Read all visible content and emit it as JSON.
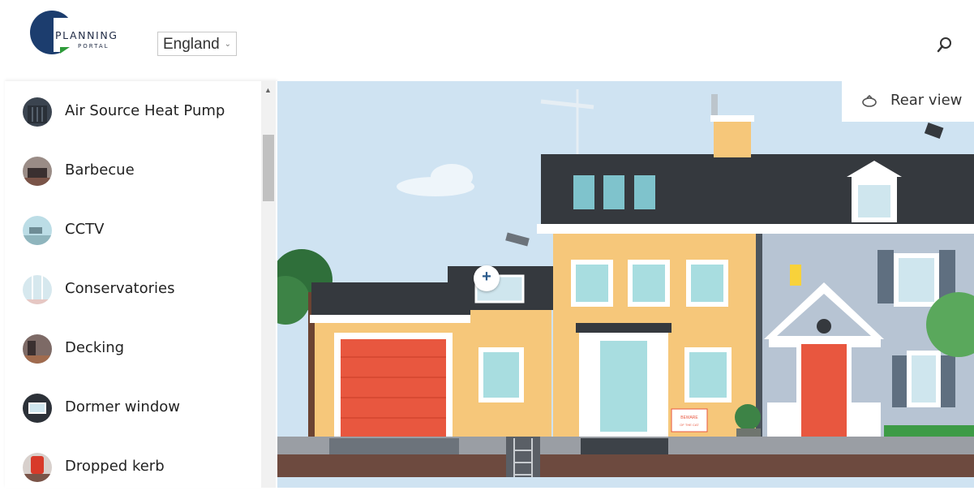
{
  "logo": {
    "line1": "PLANNING",
    "line2": "PORTAL"
  },
  "country": {
    "selected": "England"
  },
  "sidebar": {
    "items": [
      {
        "label": "Air Source Heat Pump",
        "icon": "heat-pump-icon"
      },
      {
        "label": "Barbecue",
        "icon": "barbecue-icon"
      },
      {
        "label": "CCTV",
        "icon": "cctv-icon"
      },
      {
        "label": "Conservatories",
        "icon": "conservatory-icon"
      },
      {
        "label": "Decking",
        "icon": "decking-icon"
      },
      {
        "label": "Dormer window",
        "icon": "dormer-window-icon"
      },
      {
        "label": "Dropped kerb",
        "icon": "dropped-kerb-icon"
      }
    ]
  },
  "scene": {
    "rear_view_label": "Rear view",
    "sign_text_line1": "BEWARE",
    "sign_text_line2": "OF THE CAT"
  },
  "colors": {
    "sky": "#cfe3f2",
    "roof": "#3a3d42",
    "yellow_house": "#f6c77a",
    "blue_house": "#b7c4d3",
    "red_door": "#e8573f",
    "ground": "#6d4a3f"
  }
}
